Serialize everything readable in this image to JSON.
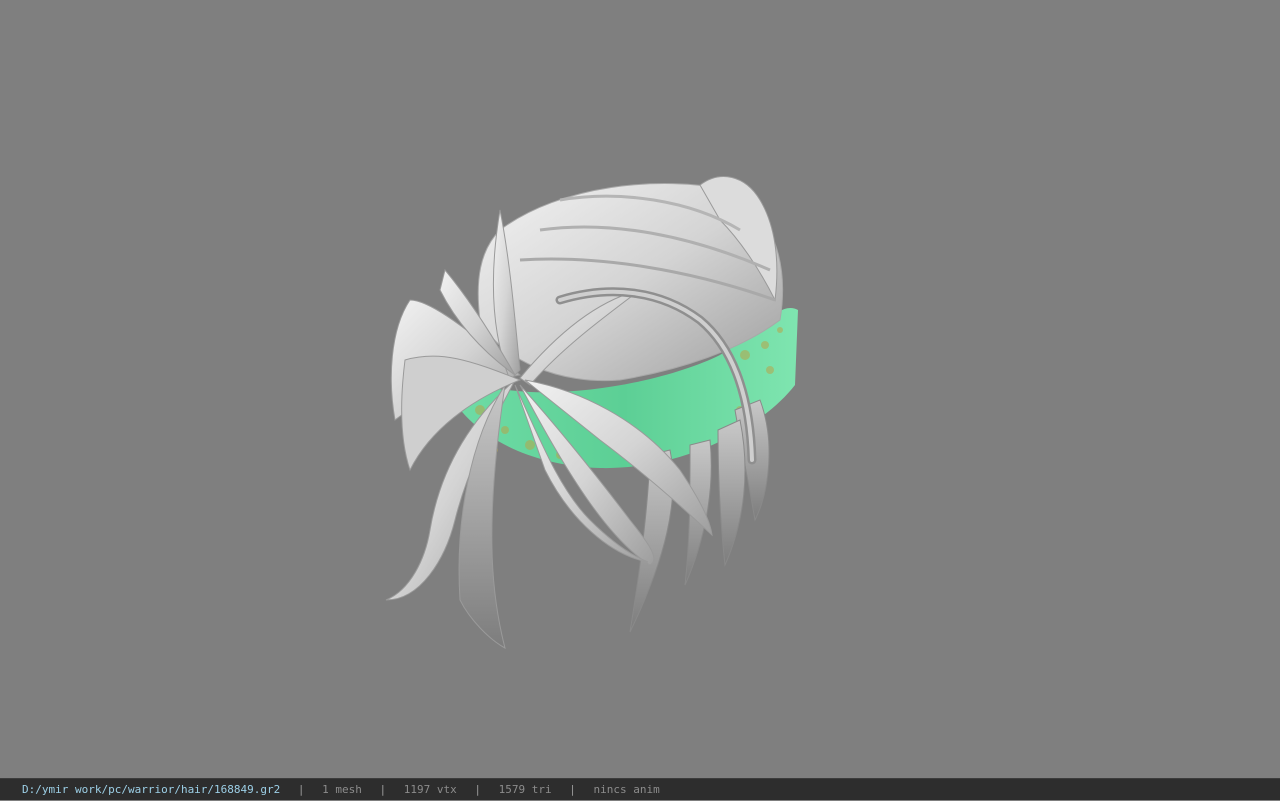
{
  "viewer": {
    "background_color": "#7f7f7f",
    "model": "hair mesh",
    "headband_color": "#5fd39a",
    "hair_color": "#d9d9d9"
  },
  "status": {
    "file_path": "D:/ymir work/pc/warrior/hair/168849.gr2",
    "sep": "|",
    "mesh": "1 mesh",
    "vertices": "1197 vtx",
    "triangles": "1579 tri",
    "anim": "nincs anim"
  }
}
